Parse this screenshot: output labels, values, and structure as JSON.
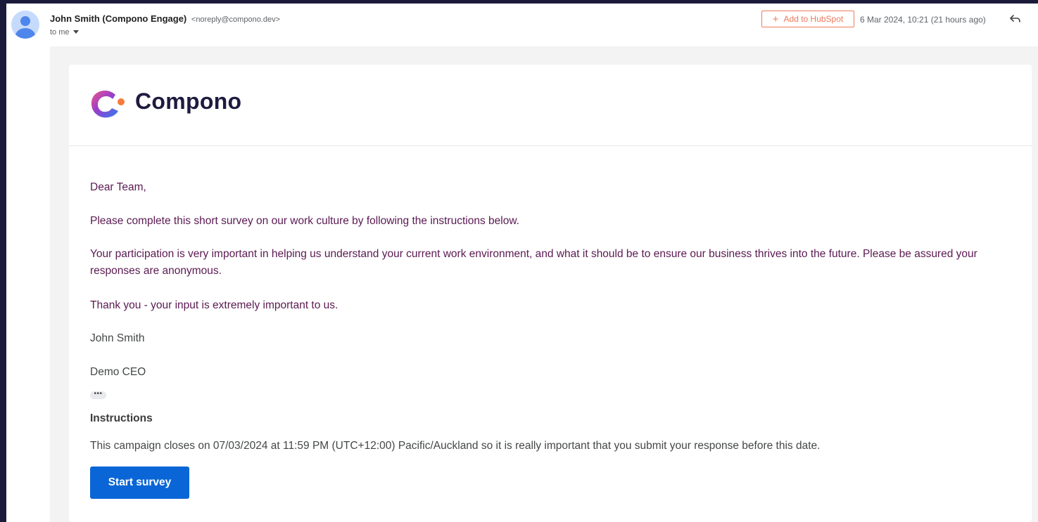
{
  "header": {
    "sender_name": "John Smith (Compono Engage)",
    "sender_email": "<noreply@compono.dev>",
    "recipient": "to me",
    "hubspot_button": "Add to HubSpot",
    "hubspot_plus": "+",
    "date": "6 Mar 2024, 10:21 (21 hours ago)"
  },
  "brand": {
    "logo_text": "Compono",
    "colors": {
      "text": "#1e1b3f",
      "gradient_start": "#2d7ff0",
      "gradient_mid": "#9b3dc9",
      "gradient_end": "#f0568a",
      "dot": "#f57b3a"
    }
  },
  "email": {
    "greeting": "Dear Team,",
    "paragraph_complete": "Please complete this short survey on our work culture by following the instructions below.",
    "paragraph_participation": "Your participation is very important in helping us understand your current work environment, and what it should be to ensure our business thrives into the future. Please be assured your responses are anonymous.",
    "paragraph_thanks": "Thank you - your input is extremely important to us.",
    "signature_name": "John Smith",
    "signature_title": "Demo CEO",
    "ellipsis": "•••",
    "instructions_heading": "Instructions",
    "instructions_text": "This campaign closes on 07/03/2024 at 11:59 PM (UTC+12:00) Pacific/Auckland so it is really important that you submit your response before this date.",
    "start_button": "Start survey"
  },
  "colors": {
    "accent_button": "#0a66d6",
    "hubspot": "#f0795a",
    "body_text": "#5a1a52",
    "frame_background": "#1c1a3b"
  },
  "icons": {
    "avatar": "person-icon",
    "reply": "reply-arrow-icon",
    "caret": "caret-down-icon"
  }
}
